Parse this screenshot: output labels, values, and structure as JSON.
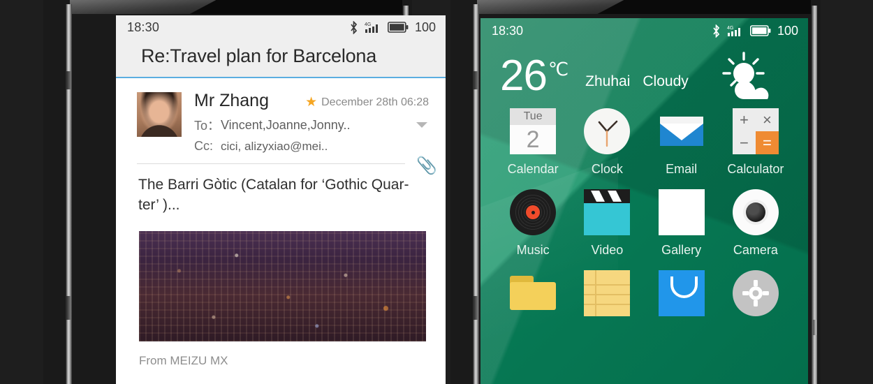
{
  "background_color": "#1e1e1e",
  "left_phone": {
    "status_bar": {
      "time": "18:30",
      "bluetooth_icon": "bluetooth-icon",
      "signal_icon": "signal-4g-icon",
      "signal_label": "4G",
      "battery_icon": "battery-icon",
      "battery_level": "100"
    },
    "app": {
      "title": "Re:Travel plan for Barcelona",
      "accent_color": "#5aaee0",
      "sender": "Mr Zhang",
      "starred": true,
      "date": "December 28th 06:28",
      "to_label": "To：",
      "to_value": "Vincent,Joanne,Jonny..",
      "cc_label": "Cc:",
      "cc_value": "cici, alizyxiao@mei..",
      "expand_icon": "chevron-down-icon",
      "attachment_icon": "paperclip-icon",
      "body_line1": "The Barri Gòtic (Catalan for ‘Gothic Quar-",
      "body_line2": "ter’ )...",
      "photo_alt": "night-cityscape-photo",
      "footer": "From  MEIZU MX"
    }
  },
  "right_phone": {
    "status_bar": {
      "time": "18:30",
      "bluetooth_icon": "bluetooth-icon",
      "signal_icon": "signal-4g-icon",
      "signal_label": "4G",
      "battery_icon": "battery-icon",
      "battery_level": "100"
    },
    "weather": {
      "temperature": "26",
      "unit": "℃",
      "city": "Zhuhai",
      "condition": "Cloudy",
      "icon": "sun-behind-cloud-icon"
    },
    "wallpaper_colors": [
      "#2e9d76",
      "#046e4c"
    ],
    "apps": [
      [
        {
          "label": "Calendar",
          "icon": "calendar-icon",
          "weekday": "Tue",
          "day": "2"
        },
        {
          "label": "Clock",
          "icon": "clock-icon"
        },
        {
          "label": "Email",
          "icon": "email-icon"
        },
        {
          "label": "Calculator",
          "icon": "calculator-icon",
          "keys": [
            "+",
            "×",
            "−",
            "="
          ]
        }
      ],
      [
        {
          "label": "Music",
          "icon": "music-vinyl-icon"
        },
        {
          "label": "Video",
          "icon": "video-clapperboard-icon"
        },
        {
          "label": "Gallery",
          "icon": "gallery-photo-icon"
        },
        {
          "label": "Camera",
          "icon": "camera-icon"
        }
      ],
      [
        {
          "label": "",
          "icon": "file-manager-folder-icon"
        },
        {
          "label": "",
          "icon": "notes-icon"
        },
        {
          "label": "",
          "icon": "app-store-icon"
        },
        {
          "label": "",
          "icon": "settings-gear-icon"
        }
      ]
    ]
  }
}
